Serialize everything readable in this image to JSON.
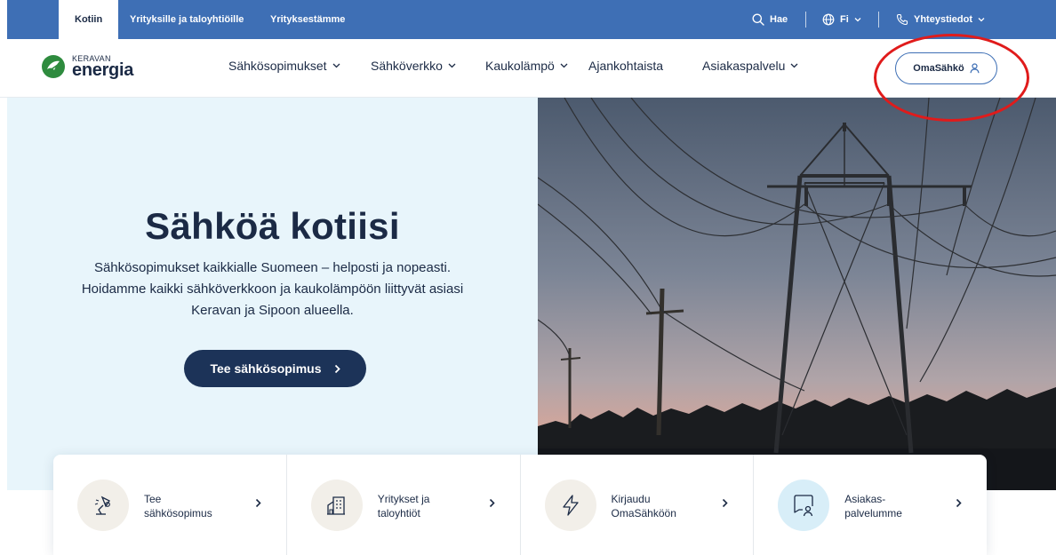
{
  "topbar": {
    "tabs": [
      {
        "label": "Kotiin",
        "active": true
      },
      {
        "label": "Yrityksille ja taloyhtiöille",
        "active": false
      },
      {
        "label": "Yrityksestämme",
        "active": false
      }
    ],
    "search_label": "Hae",
    "language_label": "Fi",
    "contact_label": "Yhteystiedot",
    "bg_color": "#3e6fb5"
  },
  "logo": {
    "small": "KERAVAN",
    "big": "energia",
    "mark_color": "#2e8b3e"
  },
  "nav": {
    "items": [
      {
        "label": "Sähkösopimukset",
        "dropdown": true
      },
      {
        "label": "Sähköverkko",
        "dropdown": true
      },
      {
        "label": "Kaukolämpö",
        "dropdown": true
      },
      {
        "label": "Ajankohtaista",
        "dropdown": false
      },
      {
        "label": "Asiakaspalvelu",
        "dropdown": true
      }
    ],
    "login_label": "OmaSähkö"
  },
  "hero": {
    "title": "Sähköä kotiisi",
    "lines": [
      "Sähkösopimukset kaikkialle Suomeen – helposti ja nopeasti.",
      "Hoidamme kaikki sähköverkkoon ja kaukolämpöön liittyvät asiasi",
      "Keravan ja Sipoon alueella."
    ],
    "cta_label": "Tee sähkösopimus",
    "bg_color": "#e8f5fb",
    "cta_color": "#1c3358"
  },
  "quick_links": [
    {
      "line1": "Tee",
      "line2": "sähkösopimus",
      "icon": "lamp-icon"
    },
    {
      "line1": "Yritykset ja",
      "line2": "taloyhtiöt",
      "icon": "building-icon"
    },
    {
      "line1": "Kirjaudu",
      "line2": "OmaSähköön",
      "icon": "lightning-icon"
    },
    {
      "line1": "Asiakas-",
      "line2": "palvelumme",
      "icon": "chat-person-icon"
    }
  ],
  "annotation_color": "#e01b1b"
}
